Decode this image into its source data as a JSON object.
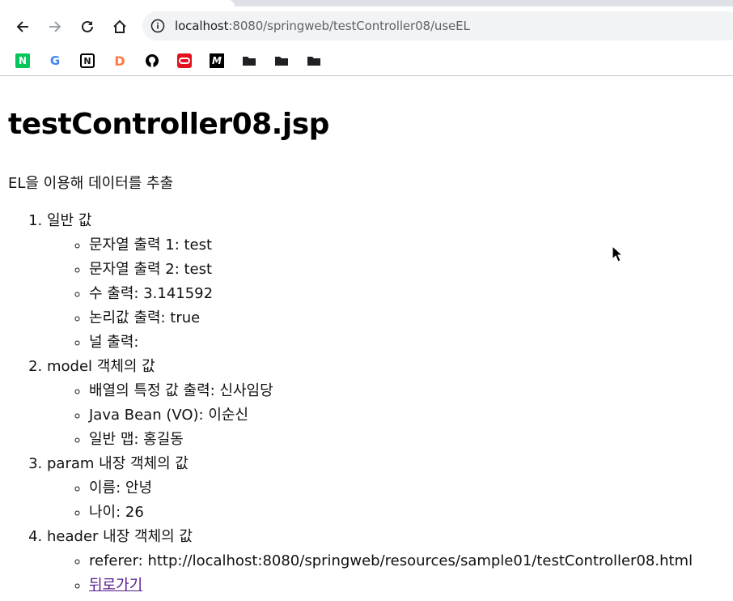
{
  "browser": {
    "url_host": "localhost",
    "url_rest": ":8080/springweb/testController08/useEL",
    "bookmarks": [
      {
        "icon": "naver-icon",
        "glyph": "N",
        "color": "#03c75a"
      },
      {
        "icon": "google-icon",
        "glyph": "G",
        "color": "#4285f4"
      },
      {
        "icon": "notion-icon",
        "glyph": "N",
        "color": "#000000"
      },
      {
        "icon": "d-app-icon",
        "glyph": "D",
        "color": "#ff7a45"
      },
      {
        "icon": "github-icon",
        "glyph": "",
        "color": "#000000"
      },
      {
        "icon": "oracle-icon",
        "glyph": "",
        "color": "#e3101e"
      },
      {
        "icon": "m-app-icon",
        "glyph": "M",
        "color": "#000000"
      },
      {
        "icon": "folder-icon",
        "glyph": "",
        "color": "#202124"
      },
      {
        "icon": "folder-icon",
        "glyph": "",
        "color": "#202124"
      },
      {
        "icon": "folder-icon",
        "glyph": "",
        "color": "#202124"
      }
    ]
  },
  "page": {
    "title": "testController08.jsp",
    "lead": "EL을 이용해 데이터를 추출",
    "sections": [
      {
        "heading": "일반 값",
        "items": [
          "문자열 출력 1: test",
          "문자열 출력 2: test",
          "수 출력: 3.141592",
          "논리값 출력: true",
          "널 출력:"
        ]
      },
      {
        "heading": "model 객체의 값",
        "items": [
          "배열의 특정 값 출력: 신사임당",
          "Java Bean (VO): 이순신",
          "일반 맵: 홍길동"
        ]
      },
      {
        "heading": "param 내장 객체의 값",
        "items": [
          "이름: 안녕",
          "나이: 26"
        ]
      },
      {
        "heading": "header 내장 객체의 값",
        "items": [
          "referer: http://localhost:8080/springweb/resources/sample01/testController08.html"
        ],
        "link": "뒤로가기"
      }
    ]
  }
}
